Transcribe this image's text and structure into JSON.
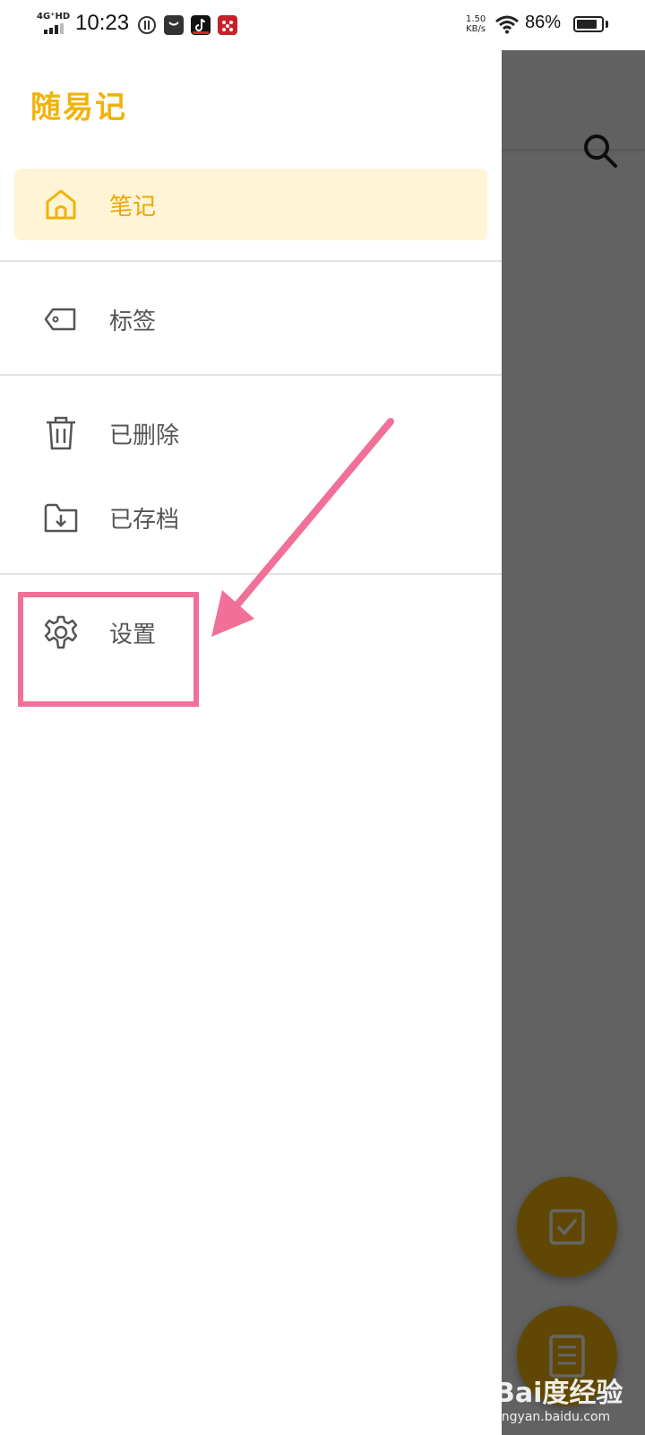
{
  "status_bar": {
    "network": "4G⁺HD",
    "time": "10:23",
    "speed_value": "1.50",
    "speed_unit": "KB/s",
    "battery": "86%",
    "battery_level": 0.86
  },
  "drawer": {
    "app_title": "随易记",
    "items": [
      {
        "label": "笔记",
        "icon": "home-icon",
        "active": true
      },
      {
        "label": "标签",
        "icon": "tag-icon",
        "active": false
      },
      {
        "label": "已删除",
        "icon": "trash-icon",
        "active": false
      },
      {
        "label": "已存档",
        "icon": "archive-icon",
        "active": false
      },
      {
        "label": "设置",
        "icon": "gear-icon",
        "active": false
      }
    ]
  },
  "background": {
    "toolbar_icon": "search-icon",
    "fabs": [
      "checkbox-icon",
      "notes-list-icon"
    ]
  },
  "watermark": {
    "main": "Bai度经验",
    "sub": "jingyan.baidu.com"
  },
  "colors": {
    "accent": "#f0b30a",
    "active_bg": "#fff4d6",
    "annotation": "#f07098"
  }
}
